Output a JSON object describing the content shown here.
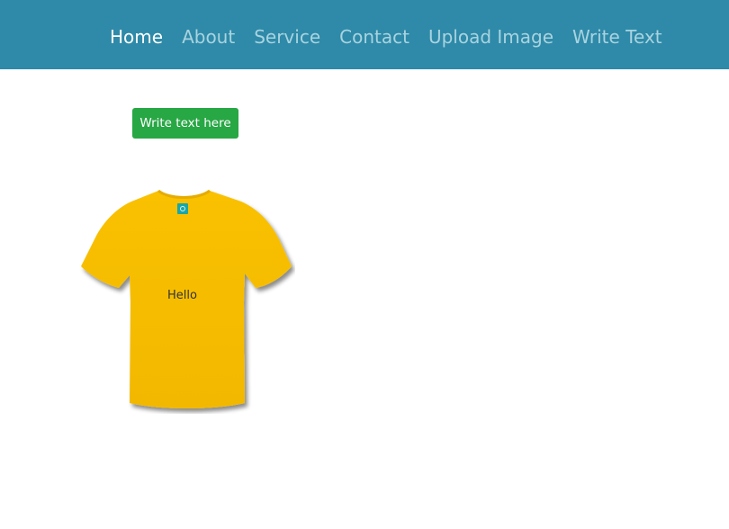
{
  "nav": {
    "items": [
      {
        "label": "Home",
        "active": true
      },
      {
        "label": "About",
        "active": false
      },
      {
        "label": "Service",
        "active": false
      },
      {
        "label": "Contact",
        "active": false
      },
      {
        "label": "Upload Image",
        "active": false
      },
      {
        "label": "Write Text",
        "active": false
      }
    ]
  },
  "toolbar": {
    "write_button_label": "Write text here"
  },
  "tshirt": {
    "text": "Hello",
    "color": "#f7bd00",
    "tag_color": "#1aa6a6",
    "icon": "tshirt-icon"
  },
  "colors": {
    "navbar": "#2e8aa8",
    "nav_active": "#ffffff",
    "nav_inactive": "#a9d3e0",
    "button": "#28a745"
  }
}
